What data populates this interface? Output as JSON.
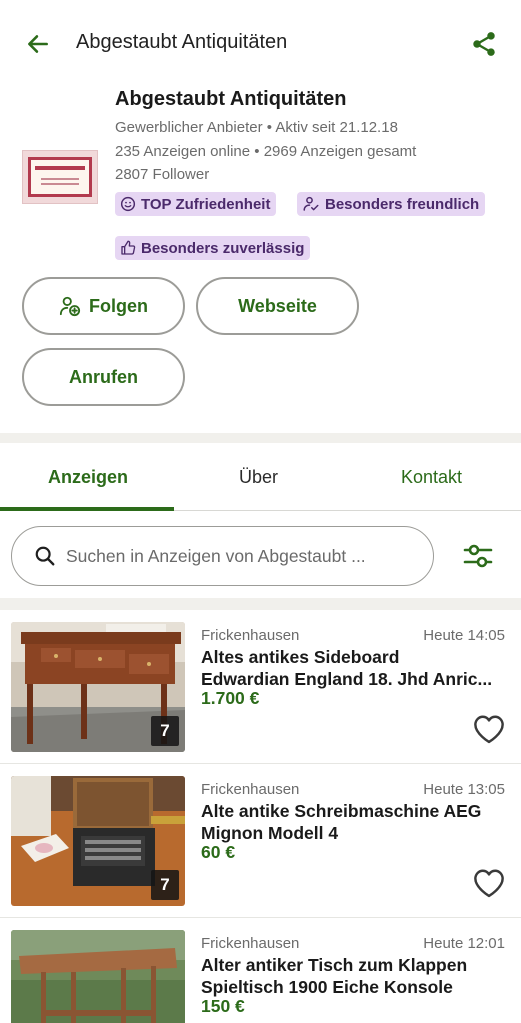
{
  "header": {
    "title": "Abgestaubt Antiquitäten",
    "back_icon": "arrow-left-icon",
    "share_icon": "share-icon"
  },
  "profile": {
    "name": "Abgestaubt Antiquitäten",
    "seller_type": "Gewerblicher Anbieter • Aktiv seit 21.12.18",
    "ads_line": "235 Anzeigen online  •  2969 Anzeigen gesamt",
    "followers": "2807 Follower",
    "logo_text": "ABGESTAUBT",
    "badges": [
      {
        "label": "TOP Zufriedenheit",
        "icon": "smile-icon"
      },
      {
        "label": "Besonders freundlich",
        "icon": "friendly-person-icon"
      },
      {
        "label": "Besonders zuverlässig",
        "icon": "thumbs-up-icon"
      }
    ],
    "buttons": {
      "follow": "Folgen",
      "website": "Webseite",
      "call": "Anrufen"
    }
  },
  "tabs": [
    {
      "label": "Anzeigen",
      "active": true
    },
    {
      "label": "Über",
      "active": false
    },
    {
      "label": "Kontakt",
      "active": false
    }
  ],
  "search": {
    "placeholder": "Suchen in Anzeigen von Abgestaubt ..."
  },
  "listings": [
    {
      "location": "Frickenhausen",
      "time": "Heute 14:05",
      "title_line1": "Altes antikes Sideboard",
      "title_line2": "Edwardian England 18. Jhd Anric...",
      "price": "1.700 €",
      "image_count": "7"
    },
    {
      "location": "Frickenhausen",
      "time": "Heute 13:05",
      "title_line1": "Alte antike Schreibmaschine AEG",
      "title_line2": "Mignon Modell 4",
      "price": "60 €",
      "image_count": "7"
    },
    {
      "location": "Frickenhausen",
      "time": "Heute 12:01",
      "title_line1": "Alter antiker Tisch zum Klappen",
      "title_line2": "Spieltisch 1900 Eiche Konsole",
      "price": "150 €",
      "image_count": ""
    }
  ],
  "colors": {
    "accent": "#2c6b1a",
    "badge_bg": "#e6d6f3",
    "badge_text": "#4b2a6b"
  }
}
